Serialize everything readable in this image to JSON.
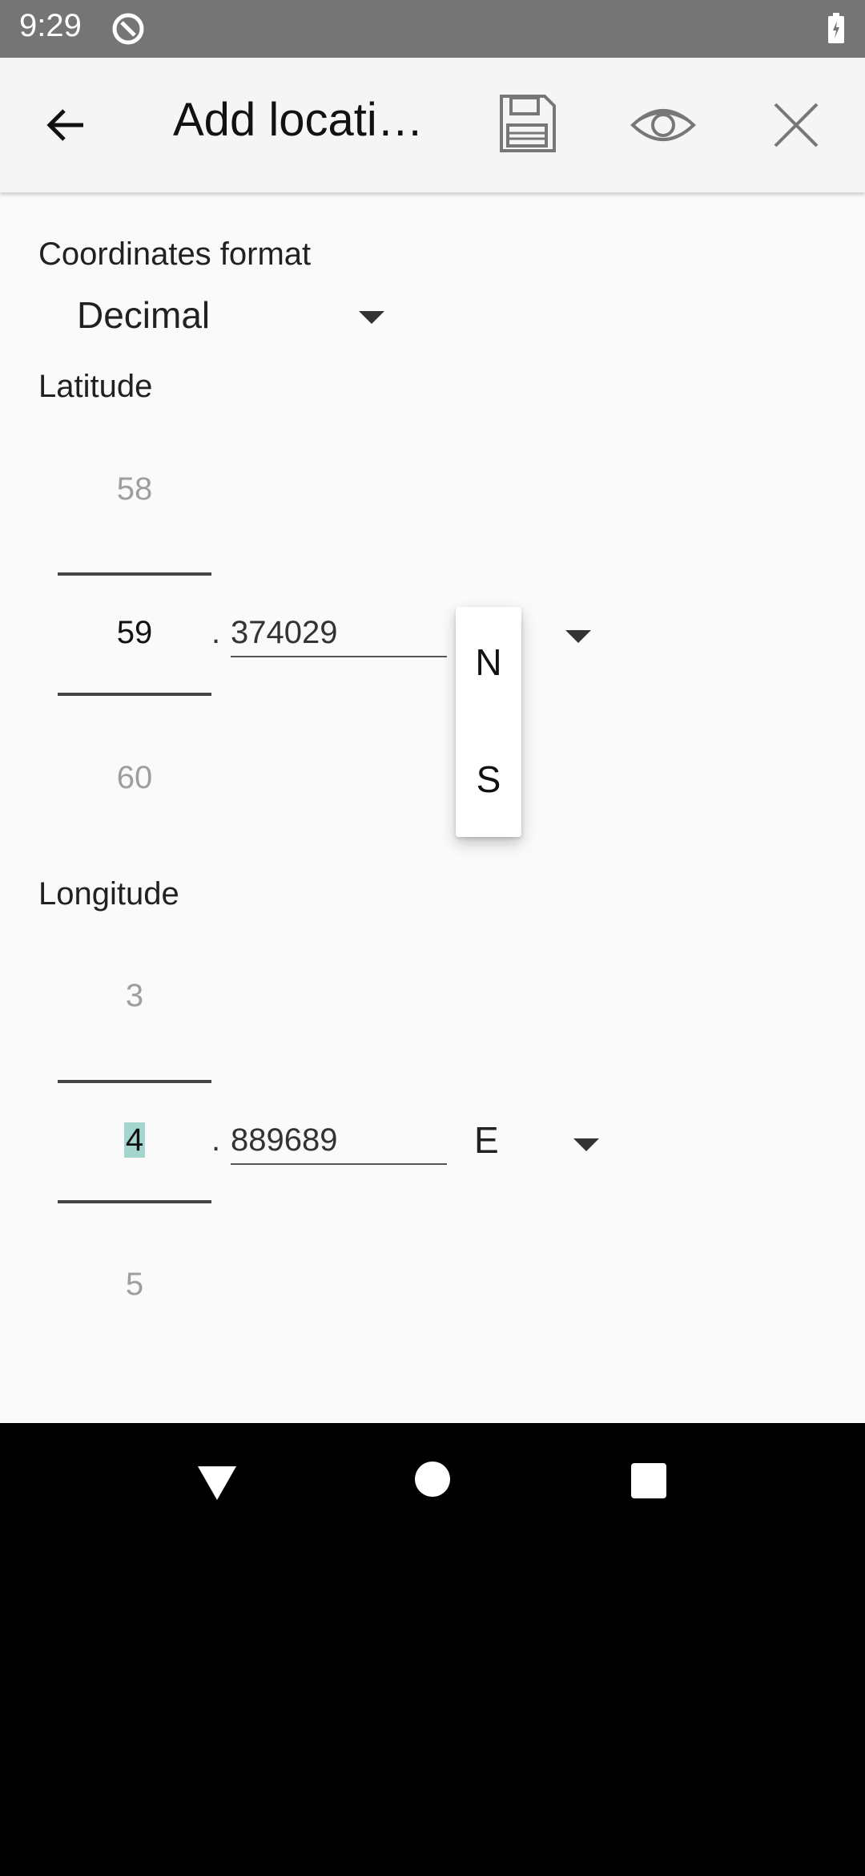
{
  "status_bar": {
    "time": "9:29"
  },
  "app_bar": {
    "title": "Add locati…"
  },
  "format": {
    "label": "Coordinates format",
    "value": "Decimal"
  },
  "latitude": {
    "label": "Latitude",
    "picker_prev": "58",
    "picker_value": "59",
    "picker_next": "60",
    "separator": ".",
    "decimal": "374029",
    "hemisphere_options": [
      "N",
      "S"
    ]
  },
  "longitude": {
    "label": "Longitude",
    "picker_prev": "3",
    "picker_value": "4",
    "picker_next": "5",
    "separator": ".",
    "decimal": "889689",
    "hemisphere": "E"
  },
  "colors": {
    "status_bar": "#757575",
    "app_bar": "#f5f5f5",
    "content_bg": "#fafafa",
    "selection_highlight": "#a4d6cf"
  }
}
